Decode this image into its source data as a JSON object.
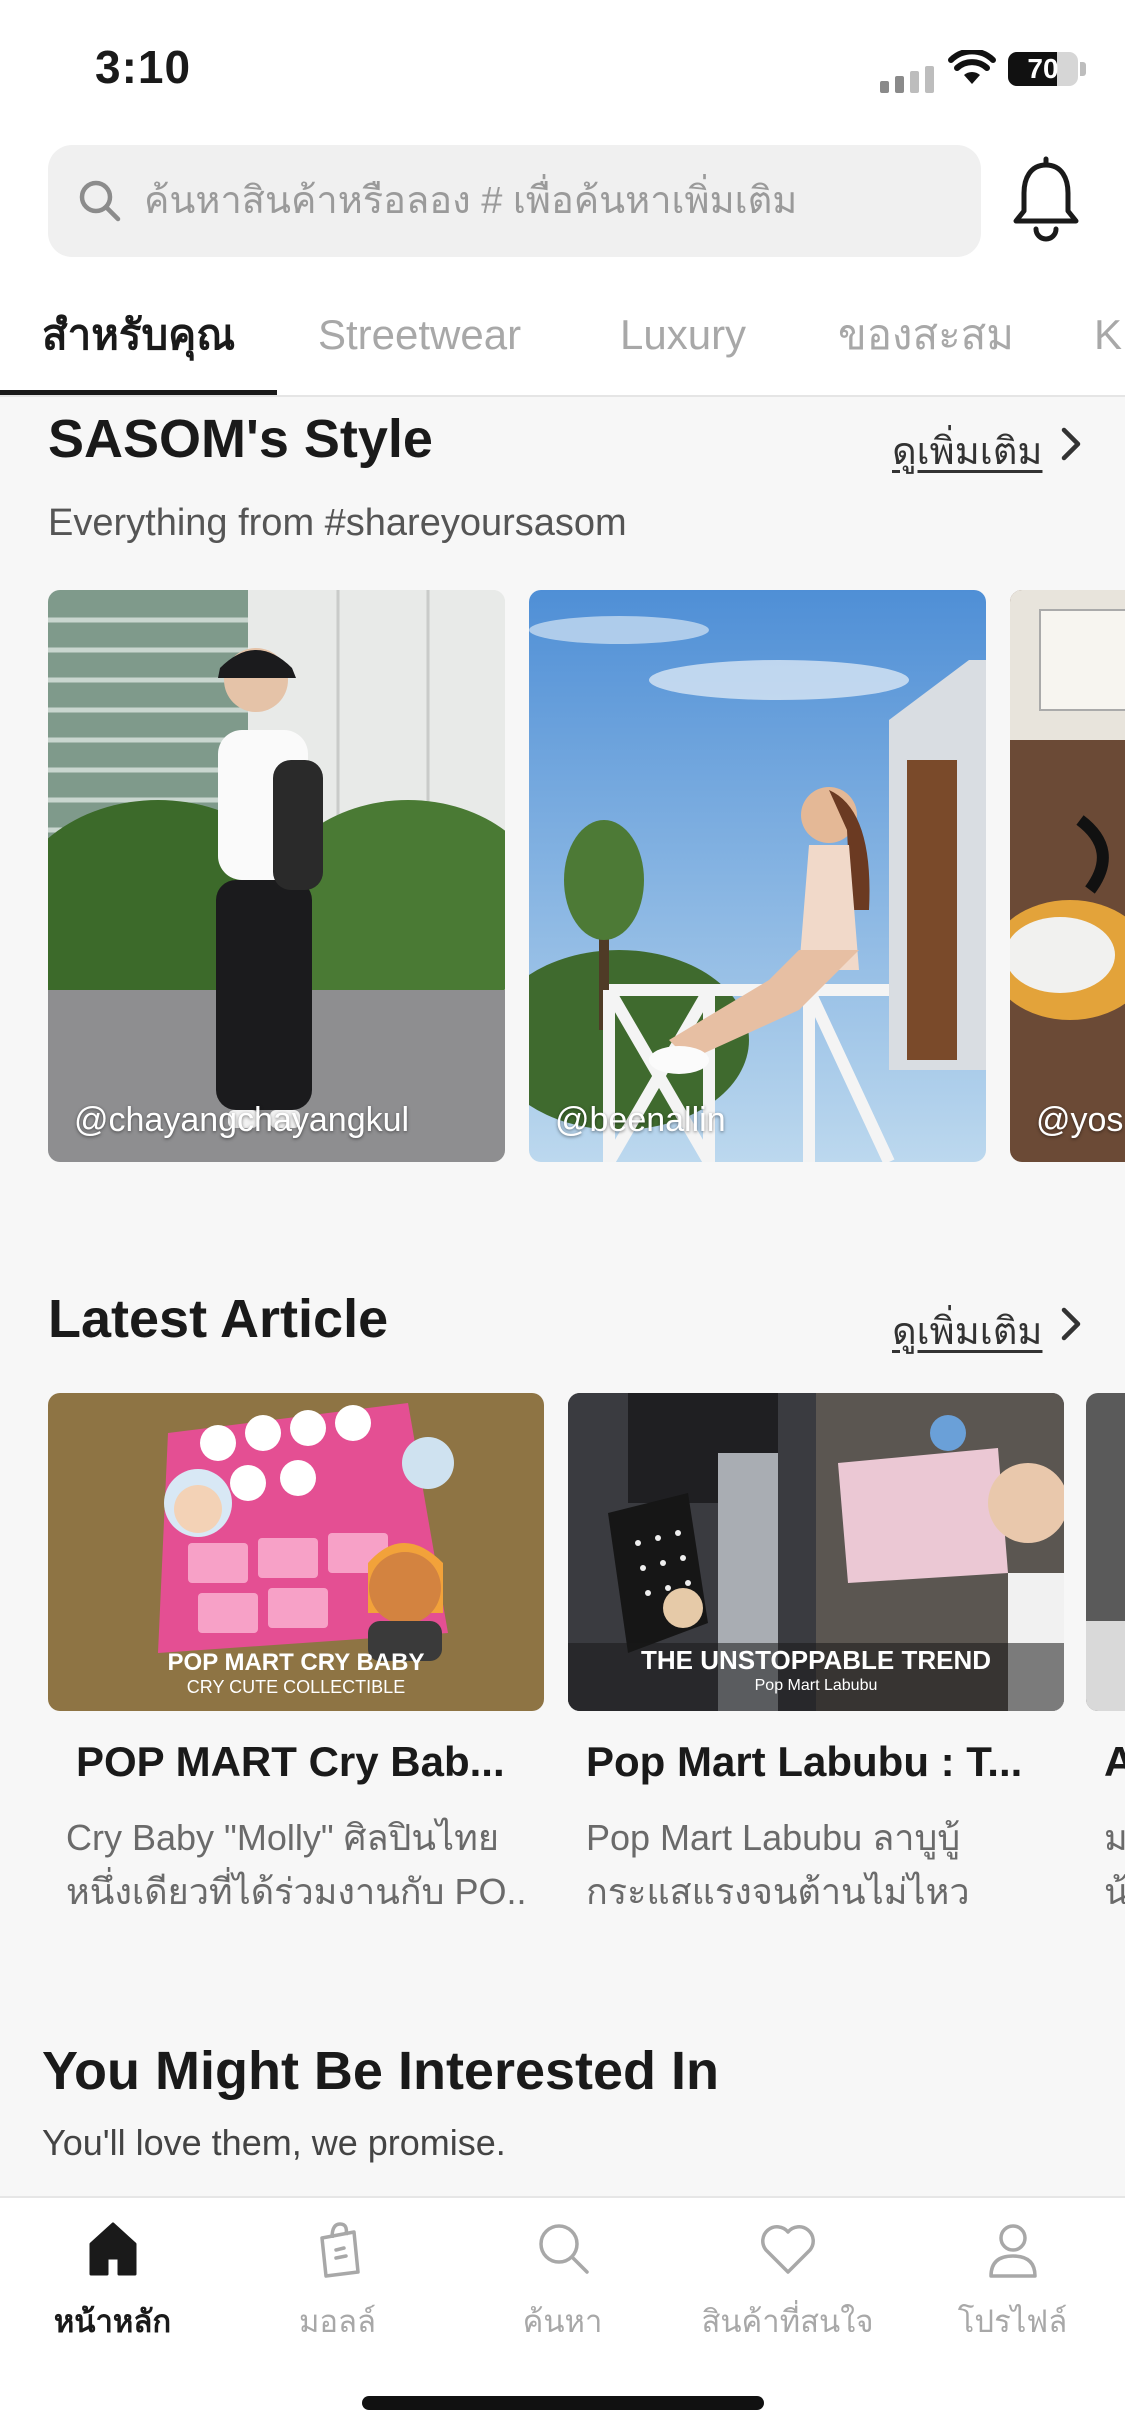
{
  "status": {
    "time": "3:10",
    "battery": "70",
    "battery_level": 0.7
  },
  "search": {
    "placeholder": "ค้นหาสินค้าหรือลอง # เพื่อค้นหาเพิ่มเติม"
  },
  "tabs": [
    {
      "label": "สำหรับคุณ",
      "active": true
    },
    {
      "label": "Streetwear",
      "active": false
    },
    {
      "label": "Luxury",
      "active": false
    },
    {
      "label": "ของสะสม",
      "active": false
    },
    {
      "label": "K",
      "active": false
    }
  ],
  "style_section": {
    "title": "SASOM's Style",
    "subtitle": "Everything from #shareyoursasom",
    "see_more": "ดูเพิ่มเติม",
    "cards": [
      {
        "handle": "@chayangchayangkul"
      },
      {
        "handle": "@beenallin"
      },
      {
        "handle": "@yos"
      }
    ]
  },
  "article_section": {
    "title": "Latest Article",
    "see_more": "ดูเพิ่มเติม",
    "articles": [
      {
        "image_caption": "POP MART CRY BABY",
        "image_subcaption": "CRY CUTE COLLECTIBLE",
        "title": "POP MART Cry Bab...",
        "desc_line1": "Cry Baby \"Molly\" ศิลปินไทย",
        "desc_line2": "หนึ่งเดียวที่ได้ร่วมงานกับ PO..."
      },
      {
        "image_caption": "THE UNSTOPPABLE TREND",
        "image_subcaption": "Pop Mart Labubu",
        "title": "Pop Mart Labubu : T...",
        "desc_line1": "Pop Mart Labubu ลาบูบู้",
        "desc_line2": "กระแสแรงจนต้านไม่ไหว"
      },
      {
        "image_caption": "",
        "image_subcaption": "",
        "title": "A",
        "desc_line1": "ม",
        "desc_line2": "น้"
      }
    ]
  },
  "interest_section": {
    "title": "You Might Be Interested In",
    "subtitle": "You'll love them, we promise."
  },
  "bottom_nav": [
    {
      "label": "หน้าหลัก",
      "icon": "home-icon",
      "active": true
    },
    {
      "label": "มอลล์",
      "icon": "shopping-bag-icon",
      "active": false
    },
    {
      "label": "ค้นหา",
      "icon": "search-icon",
      "active": false
    },
    {
      "label": "สินค้าที่สนใจ",
      "icon": "heart-icon",
      "active": false
    },
    {
      "label": "โปรไฟล์",
      "icon": "profile-icon",
      "active": false
    }
  ]
}
